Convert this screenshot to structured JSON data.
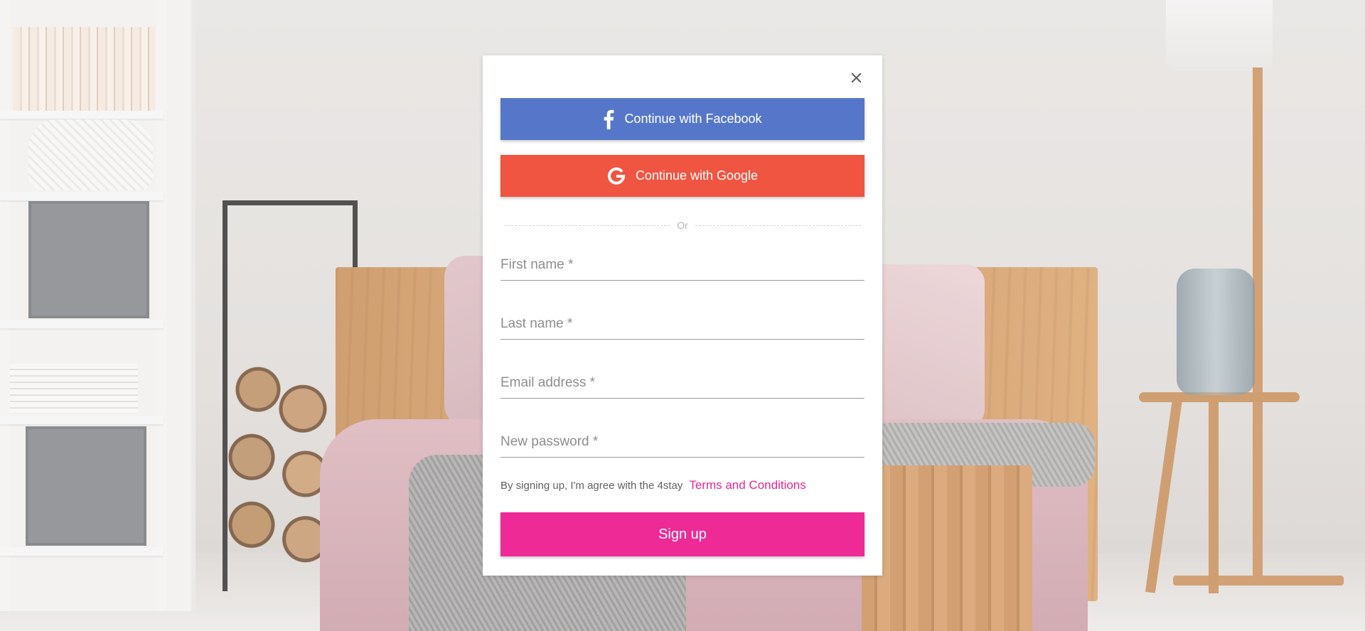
{
  "modal": {
    "close_icon": "close-icon",
    "facebook": {
      "label": "Continue with Facebook",
      "icon": "facebook-icon",
      "color": "#5677c9"
    },
    "google": {
      "label": "Continue with Google",
      "icon": "google-icon",
      "color": "#f05541"
    },
    "divider_text": "Or",
    "fields": {
      "first_name": {
        "placeholder": "First name *",
        "value": ""
      },
      "last_name": {
        "placeholder": "Last name *",
        "value": ""
      },
      "email": {
        "placeholder": "Email address *",
        "value": ""
      },
      "password": {
        "placeholder": "New password *",
        "value": ""
      }
    },
    "terms": {
      "text": "By signing up, I'm agree with the 4stay",
      "link": "Terms and Conditions",
      "link_color": "#e8268f"
    },
    "signup": {
      "label": "Sign up",
      "color": "#ee2a97"
    }
  }
}
